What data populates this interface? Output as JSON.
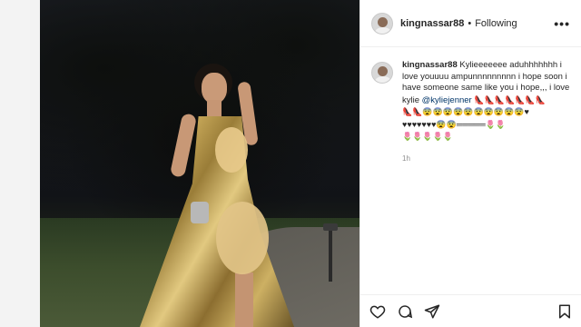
{
  "header": {
    "username": "kingnassar88",
    "separator": "•",
    "follow_status": "Following",
    "more_label": "•••"
  },
  "caption": {
    "username": "kingnassar88",
    "text": "Kylieeeeeee aduhhhhhhh i love youuuu ampunnnnnnnnn i hope soon i have someone same like you i hope,,, i love kylie",
    "mention": "@kyliejenner",
    "emoji_line1": "👠👠👠👠👠👠👠",
    "emoji_line2": "👠👠😨😨😨😨😨😨😨😨😨😨♥",
    "emoji_line3": "♥♥♥♥♥♥♥😨😨═════🌷🌷",
    "emoji_line4": "🌷🌷🌷🌷🌷"
  },
  "timestamp": "1h",
  "icons": {
    "like": "heart-icon",
    "comment": "comment-icon",
    "share": "share-icon",
    "save": "bookmark-icon"
  }
}
